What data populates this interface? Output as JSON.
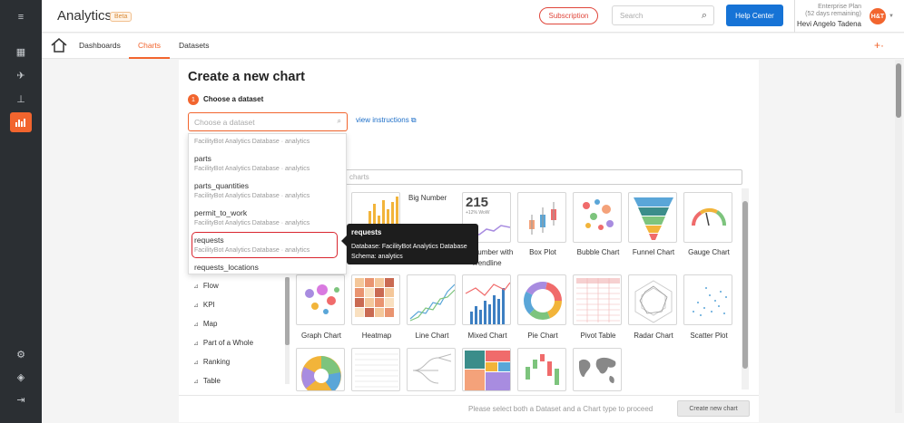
{
  "app": {
    "title": "Analytics",
    "badge": "Beta"
  },
  "header": {
    "subscription": "Subscription",
    "search_placeholder": "Search",
    "help": "Help Center",
    "plan": "Enterprise Plan",
    "plan_days": "(52 days remaining)",
    "user": "Hevi Angelo Tadena",
    "avatar": "H&T"
  },
  "subnav": {
    "tabs": [
      "Dashboards",
      "Charts",
      "Datasets"
    ],
    "active": "Charts"
  },
  "page": {
    "title": "Create a new chart",
    "step_num": "1",
    "step_label": "Choose a dataset",
    "dataset_placeholder": "Choose a dataset",
    "view_instructions": "view instructions",
    "chart_search_placeholder": "charts"
  },
  "dropdown": {
    "items": [
      {
        "name": "parts",
        "sub": "FacilityBot Analytics Database · analytics"
      },
      {
        "name": "parts_quantities",
        "sub": "FacilityBot Analytics Database · analytics"
      },
      {
        "name": "permit_to_work",
        "sub": "FacilityBot Analytics Database · analytics"
      },
      {
        "name": "requests",
        "sub": "FacilityBot Analytics Database · analytics"
      },
      {
        "name": "requests_locations",
        "sub": ""
      }
    ],
    "partial_sub": "FacilityBot Analytics Database · analytics",
    "highlighted": "requests"
  },
  "tooltip": {
    "title": "requests",
    "database": "Database: FacilityBot Analytics Database",
    "schema": "Schema: analytics"
  },
  "categories": [
    "Flow",
    "KPI",
    "Map",
    "Part of a Whole",
    "Ranking",
    "Table"
  ],
  "charts": {
    "row1": [
      "Big Number",
      "Big Number with Trendline",
      "Box Plot",
      "Bubble Chart",
      "Funnel Chart",
      "Gauge Chart"
    ],
    "row2": [
      "Graph Chart",
      "Heatmap",
      "Line Chart",
      "Mixed Chart",
      "Pie Chart",
      "Pivot Table",
      "Radar Chart",
      "Scatter Plot"
    ],
    "bignum_value": "215",
    "bignum_sub": "+12% WoW"
  },
  "footer": {
    "hint": "Please select both a Dataset and a Chart type to proceed",
    "create": "Create new chart"
  },
  "colors": {
    "accent": "#f2652e",
    "help": "#1673d6",
    "nav": "#2b2f33"
  }
}
